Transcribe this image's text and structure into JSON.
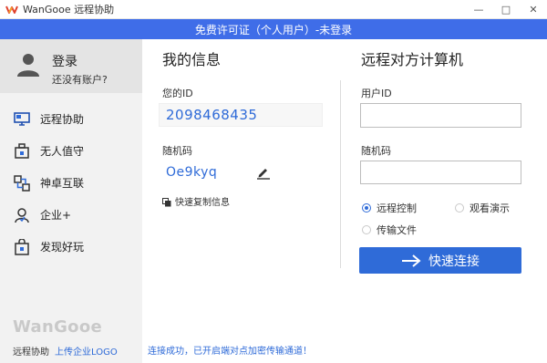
{
  "window": {
    "title": "WanGooe 远程协助",
    "controls": [
      "—",
      "□",
      "✕"
    ]
  },
  "banner": {
    "text": "免费许可证（个人用户）-未登录"
  },
  "sidebar": {
    "login": {
      "title": "登录",
      "subtitle": "还没有账户?"
    },
    "items": [
      {
        "label": "远程协助",
        "icon": "monitor-icon"
      },
      {
        "label": "无人值守",
        "icon": "unattended-icon"
      },
      {
        "label": "神卓互联",
        "icon": "network-icon"
      },
      {
        "label": "企业+",
        "icon": "enterprise-icon"
      },
      {
        "label": "发现好玩",
        "icon": "bag-icon"
      }
    ],
    "brand": "WanGooe",
    "footer_label": "远程协助",
    "upload_logo": "上传企业LOGO"
  },
  "my_info": {
    "title": "我的信息",
    "id_label": "您的ID",
    "id_value": "2098468435",
    "code_label": "随机码",
    "code_value": "Oe9kyq",
    "copy_label": "快速复制信息"
  },
  "remote": {
    "title": "远程对方计算机",
    "user_id_label": "用户ID",
    "user_id_value": "",
    "code_label": "随机码",
    "code_value": "",
    "options": [
      {
        "label": "远程控制",
        "selected": true
      },
      {
        "label": "观看演示",
        "selected": false
      },
      {
        "label": "传输文件",
        "selected": false
      }
    ],
    "connect_label": "快速连接"
  },
  "status": {
    "text": "连接成功，已开启端对点加密传输通道！"
  },
  "colors": {
    "accent": "#2f6bd8",
    "banner": "#3f6de8",
    "sidebar_bg": "#f2f2f2"
  }
}
